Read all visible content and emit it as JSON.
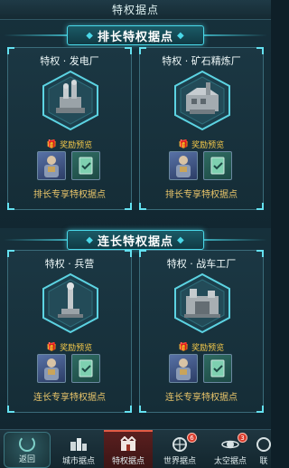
{
  "header": {
    "title": "特权据点"
  },
  "sections": [
    {
      "title": "排长特权据点",
      "cards": [
        {
          "name": "特权 · 发电厂",
          "reward_label": "奖励预览",
          "desc": "排长专享特权据点",
          "building_icon": "power-plant-icon"
        },
        {
          "name": "特权 · 矿石精炼厂",
          "reward_label": "奖励预览",
          "desc": "排长专享特权据点",
          "building_icon": "refinery-icon"
        }
      ]
    },
    {
      "title": "连长特权据点",
      "cards": [
        {
          "name": "特权 · 兵营",
          "reward_label": "奖励预览",
          "desc": "连长专享特权据点",
          "building_icon": "barracks-icon"
        },
        {
          "name": "特权 · 战车工厂",
          "reward_label": "奖励预览",
          "desc": "连长专享特权据点",
          "building_icon": "war-factory-icon"
        }
      ]
    }
  ],
  "nav": {
    "back_label": "返回",
    "tabs": [
      {
        "label": "城市据点",
        "icon": "city-icon"
      },
      {
        "label": "特权据点",
        "icon": "privilege-icon",
        "active": true
      },
      {
        "label": "世界据点",
        "icon": "world-icon",
        "badge": "6"
      },
      {
        "label": "太空据点",
        "icon": "space-icon",
        "badge": "3"
      },
      {
        "label": "联",
        "icon": "alliance-icon"
      }
    ]
  },
  "colors": {
    "accent": "#4ad8e8",
    "gold": "#e9c56a",
    "active_tab": "#e35a45"
  }
}
